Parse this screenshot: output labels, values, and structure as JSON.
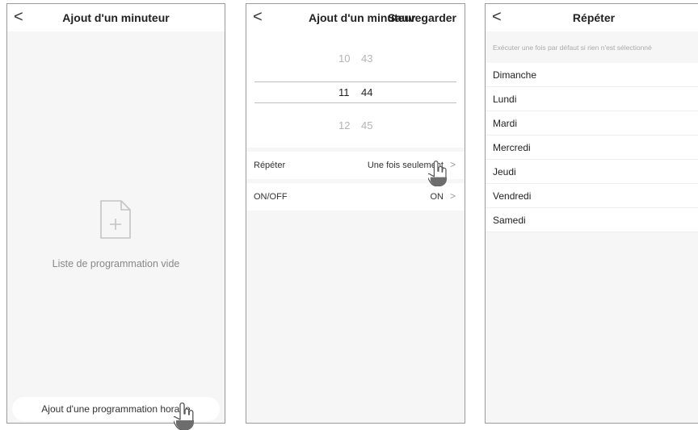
{
  "screen1": {
    "back_icon": "chevron-left-icon",
    "back_glyph": "<",
    "title": "Ajout d'un minuteur",
    "empty_icon": "document-add-icon",
    "empty_text": "Liste de programmation vide",
    "add_button": "Ajout d'une programmation horaire"
  },
  "screen2": {
    "back_glyph": "<",
    "title": "Ajout d'un minuteur",
    "save": "Sauvegarder",
    "picker": [
      {
        "hour": "10",
        "minute": "43"
      },
      {
        "hour": "11",
        "minute": "44"
      },
      {
        "hour": "12",
        "minute": "45"
      }
    ],
    "repeat": {
      "label": "Répéter",
      "value": "Une fois seulement",
      "chevron": ">"
    },
    "onoff": {
      "label": "ON/OFF",
      "value": "ON",
      "chevron": ">"
    }
  },
  "screen3": {
    "back_glyph": "<",
    "title": "Répéter",
    "hint": "Exécuter une fois par défaut si rien n'est sélectionné",
    "days": [
      "Dimanche",
      "Lundi",
      "Mardi",
      "Mercredi",
      "Jeudi",
      "Vendredi",
      "Samedi"
    ]
  }
}
